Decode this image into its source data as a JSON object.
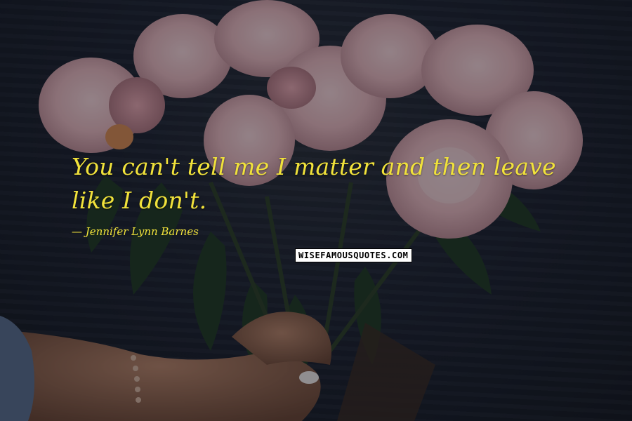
{
  "quote": {
    "text": "You can't tell me I matter and then leave like I don't.",
    "author": "— Jennifer Lynn Barnes",
    "color": "#f1e23b"
  },
  "watermark": {
    "text": "WISEFAMOUSQUOTES.COM"
  },
  "background": {
    "color": "#1b2029",
    "flower_color": "#e8b9bf"
  }
}
